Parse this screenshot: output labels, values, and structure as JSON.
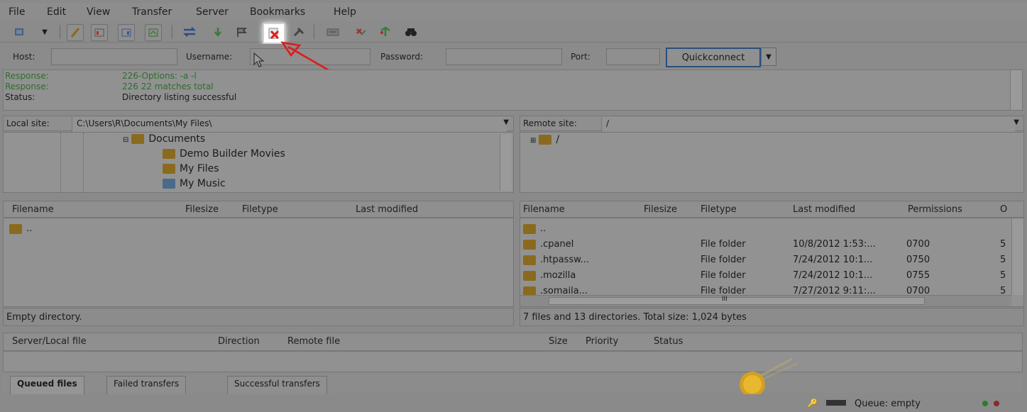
{
  "menu": [
    "File",
    "Edit",
    "View",
    "Transfer",
    "Server",
    "Bookmarks",
    "Help"
  ],
  "quickconnect": {
    "host_label": "Host:",
    "username_label": "Username:",
    "password_label": "Password:",
    "port_label": "Port:",
    "button_label": "Quickconnect",
    "dropdown_icon": "chevron-down-icon"
  },
  "log": [
    {
      "key": "Response:",
      "value": "226-Options: -a -l",
      "color": "#2d6e2d"
    },
    {
      "key": "Response:",
      "value": "226 22 matches total",
      "color": "#2d6e2d"
    },
    {
      "key": "Status:",
      "value": "Directory listing successful",
      "color": "#1a1a1a"
    }
  ],
  "local": {
    "site_label": "Local site:",
    "path": "C:\\Users\\R\\Documents\\My Files\\",
    "tree": [
      "Documents",
      "Demo Builder Movies",
      "My Files",
      "My Music"
    ],
    "columns": [
      "Filename",
      "Filesize",
      "Filetype",
      "Last modified"
    ],
    "rows": [
      {
        "name": ".."
      }
    ],
    "status": "Empty directory."
  },
  "remote": {
    "site_label": "Remote site:",
    "path": "/",
    "tree": [
      "/"
    ],
    "columns": [
      "Filename",
      "Filesize",
      "Filetype",
      "Last modified",
      "Permissions",
      "O"
    ],
    "rows": [
      {
        "name": "..",
        "type": "",
        "modified": "",
        "perm": "",
        "o": ""
      },
      {
        "name": ".cpanel",
        "type": "File folder",
        "modified": "10/8/2012 1:53:...",
        "perm": "0700",
        "o": "5"
      },
      {
        "name": ".htpassw...",
        "type": "File folder",
        "modified": "7/24/2012 10:1...",
        "perm": "0750",
        "o": "5"
      },
      {
        "name": ".mozilla",
        "type": "File folder",
        "modified": "7/24/2012 10:1...",
        "perm": "0755",
        "o": "5"
      },
      {
        "name": ".somaila...",
        "type": "File folder",
        "modified": "7/27/2012 9:11:...",
        "perm": "0700",
        "o": "5"
      }
    ],
    "status": "7 files and 13 directories. Total size: 1,024 bytes"
  },
  "queue": {
    "columns": [
      "Server/Local file",
      "Direction",
      "Remote file",
      "Size",
      "Priority",
      "Status"
    ],
    "tabs": [
      "Queued files",
      "Failed transfers",
      "Successful transfers"
    ],
    "status": "Queue: empty",
    "hscroll_marker": "III"
  },
  "colors": {
    "accent_red": "#e01a1a",
    "highlight": "#ffffff"
  }
}
